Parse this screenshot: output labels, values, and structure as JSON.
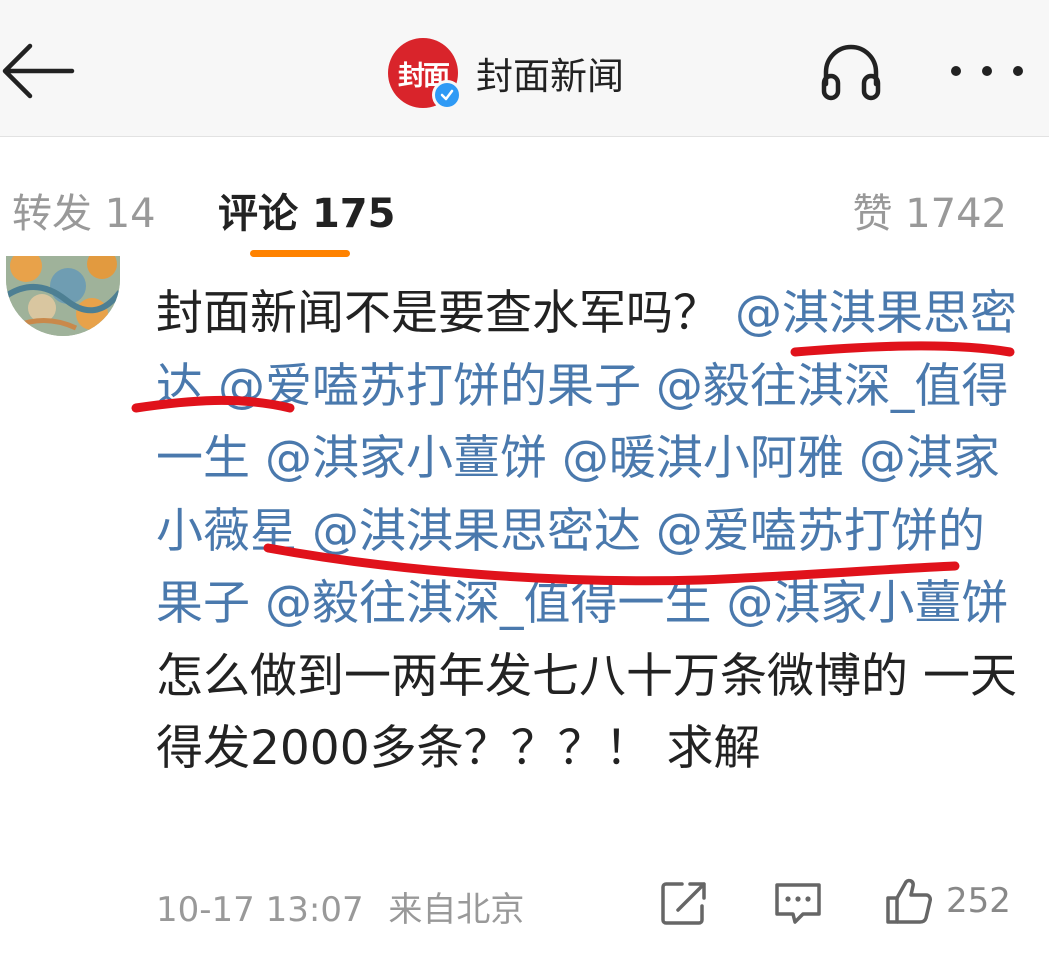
{
  "header": {
    "title": "封面新闻",
    "logo_text": "封面",
    "icons": [
      "arrow-left-icon",
      "verified-badge-icon",
      "headphones-icon",
      "more-dots-icon"
    ]
  },
  "tabs": [
    {
      "label": "转发",
      "count": "14"
    },
    {
      "label": "评论",
      "count": "175"
    },
    {
      "label": "赞",
      "count": "1742"
    }
  ],
  "colors": {
    "accent_orange": "#ff8200",
    "mention_blue": "#4a79ad",
    "logo_red": "#d9242b",
    "annotation_red": "#e0121b",
    "verified_blue": "#2f9af5"
  },
  "comment": {
    "segments": [
      {
        "text": "封面新闻不是要查水军吗？ ",
        "mention": false
      },
      {
        "text": "@淇淇果思密达",
        "mention": true
      },
      {
        "text": " ",
        "mention": false
      },
      {
        "text": "@爱嗑苏打饼的果子",
        "mention": true
      },
      {
        "text": "  ",
        "mention": false
      },
      {
        "text": "@毅往淇深_值得一生",
        "mention": true
      },
      {
        "text": "  ",
        "mention": false
      },
      {
        "text": "@淇家小薑饼",
        "mention": true
      },
      {
        "text": " ",
        "mention": false
      },
      {
        "text": "@暖淇小阿雅",
        "mention": true
      },
      {
        "text": " ",
        "mention": false
      },
      {
        "text": "@淇家小薇星",
        "mention": true
      },
      {
        "text": " ",
        "mention": false
      },
      {
        "text": "@淇淇果思密达",
        "mention": true
      },
      {
        "text": " ",
        "mention": false
      },
      {
        "text": "@爱嗑苏打饼的果子",
        "mention": true
      },
      {
        "text": " ",
        "mention": false
      },
      {
        "text": "@毅往淇深_值得一生",
        "mention": true
      },
      {
        "text": "  ",
        "mention": false
      },
      {
        "text": "@淇家小薑饼",
        "mention": true
      },
      {
        "text": " 怎么做到一两年发七八十万条微博的 一天得发2000多条？？？！ 求解",
        "mention": false
      }
    ],
    "timestamp": "10-17 13:07",
    "source": "来自北京",
    "like_count": "252",
    "action_icons": [
      "share-icon",
      "comment-icon",
      "thumbs-up-icon"
    ]
  }
}
